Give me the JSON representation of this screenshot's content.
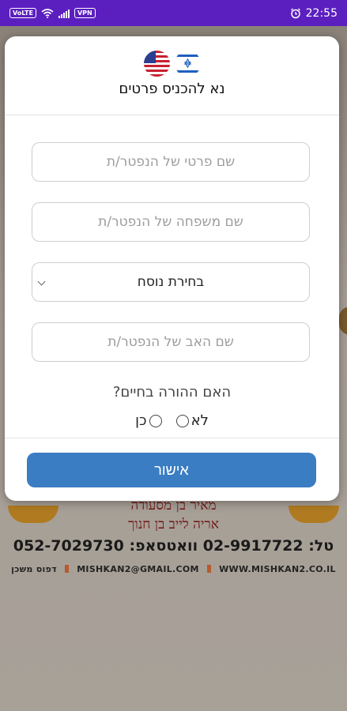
{
  "status_bar": {
    "volte": "VoLTE",
    "vpn": "VPN",
    "time": "22:55",
    "bg_color": "#5b1fc0"
  },
  "modal": {
    "title": "נא להכניס פרטים",
    "flags": [
      "israel-flag-icon",
      "usa-flag-icon"
    ],
    "first_name_placeholder": "שם פרטי של הנפטר/ת",
    "last_name_placeholder": "שם משפחה של הנפטר/ת",
    "nusach_select": "בחירת נוסח",
    "father_name_placeholder": "שם האב של הנפטר/ת",
    "question": "האם ההורה בחיים?",
    "option_no": "לא",
    "option_yes": "כן",
    "confirm_label": "אישור",
    "accent": "#3a7dc2"
  },
  "background": {
    "line1": "מאיר בן מסעודה",
    "line2": "אריה לייב בן חנוך",
    "phone": "טל: 02-9917722 וואטסאפ: 052-7029730",
    "email": "MISHKAN2@GMAIL.COM",
    "website": "WWW.MISHKAN2.CO.IL",
    "print_label": "דפוס משכן"
  }
}
